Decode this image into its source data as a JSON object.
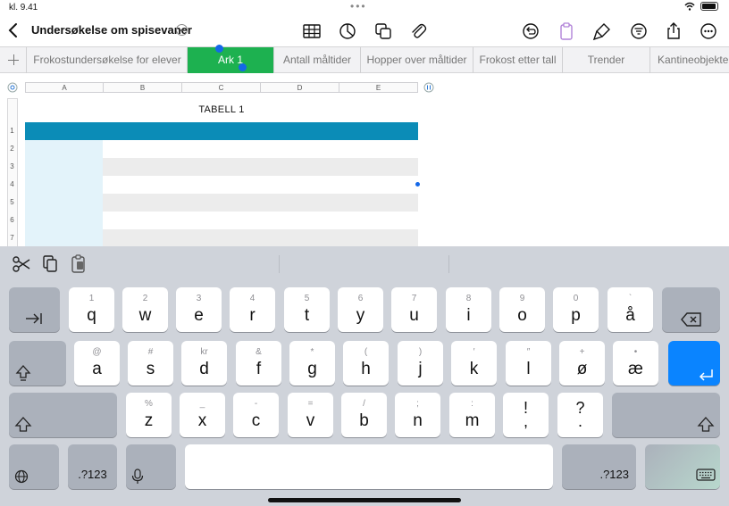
{
  "status": {
    "time": "kl. 9.41"
  },
  "document": {
    "title": "Undersøkelse om spisevaner"
  },
  "toolbar": {
    "icons": [
      "table-icon",
      "chart-icon",
      "shapes-icon",
      "paperclip-icon",
      "undo-icon",
      "clipboard-icon",
      "format-brush-icon",
      "organize-icon",
      "share-icon",
      "more-icon"
    ]
  },
  "tabs": [
    {
      "label": "Frokostundersøkelse for elever"
    },
    {
      "label": "Ark 1"
    },
    {
      "label": "Antall måltider"
    },
    {
      "label": "Hopper over måltider"
    },
    {
      "label": "Frokost etter tall"
    },
    {
      "label": "Trender"
    },
    {
      "label": "Kantineobjekter"
    }
  ],
  "sheet": {
    "columns": [
      "A",
      "B",
      "C",
      "D",
      "E"
    ],
    "rows": [
      "1",
      "2",
      "3",
      "4",
      "5",
      "6",
      "7"
    ],
    "table_title": "TABELL 1",
    "header_color": "#0b8cb7",
    "header_col_color": "#e3f3fa",
    "band_color": "#ececec"
  },
  "keyboard": {
    "row1": [
      {
        "hint": "1",
        "key": "q"
      },
      {
        "hint": "2",
        "key": "w"
      },
      {
        "hint": "3",
        "key": "e"
      },
      {
        "hint": "4",
        "key": "r"
      },
      {
        "hint": "5",
        "key": "t"
      },
      {
        "hint": "6",
        "key": "y"
      },
      {
        "hint": "7",
        "key": "u"
      },
      {
        "hint": "8",
        "key": "i"
      },
      {
        "hint": "9",
        "key": "o"
      },
      {
        "hint": "0",
        "key": "p"
      },
      {
        "hint": "`",
        "key": "å"
      }
    ],
    "row2": [
      {
        "hint": "@",
        "key": "a"
      },
      {
        "hint": "#",
        "key": "s"
      },
      {
        "hint": "kr",
        "key": "d"
      },
      {
        "hint": "&",
        "key": "f"
      },
      {
        "hint": "*",
        "key": "g"
      },
      {
        "hint": "(",
        "key": "h"
      },
      {
        "hint": ")",
        "key": "j"
      },
      {
        "hint": "′",
        "key": "k"
      },
      {
        "hint": "″",
        "key": "l"
      },
      {
        "hint": "+",
        "key": "ø"
      },
      {
        "hint": "•",
        "key": "æ"
      }
    ],
    "row3": [
      {
        "hint": "%",
        "key": "z"
      },
      {
        "hint": "_",
        "key": "x"
      },
      {
        "hint": "-",
        "key": "c"
      },
      {
        "hint": "=",
        "key": "v"
      },
      {
        "hint": "/",
        "key": "b"
      },
      {
        "hint": ";",
        "key": "n"
      },
      {
        "hint": ":",
        "key": "m"
      },
      {
        "hint": "!",
        "key": ","
      },
      {
        "hint": "?",
        "key": "."
      }
    ],
    "numbers_label": ".?123",
    "accent_color": "#0a84ff"
  }
}
